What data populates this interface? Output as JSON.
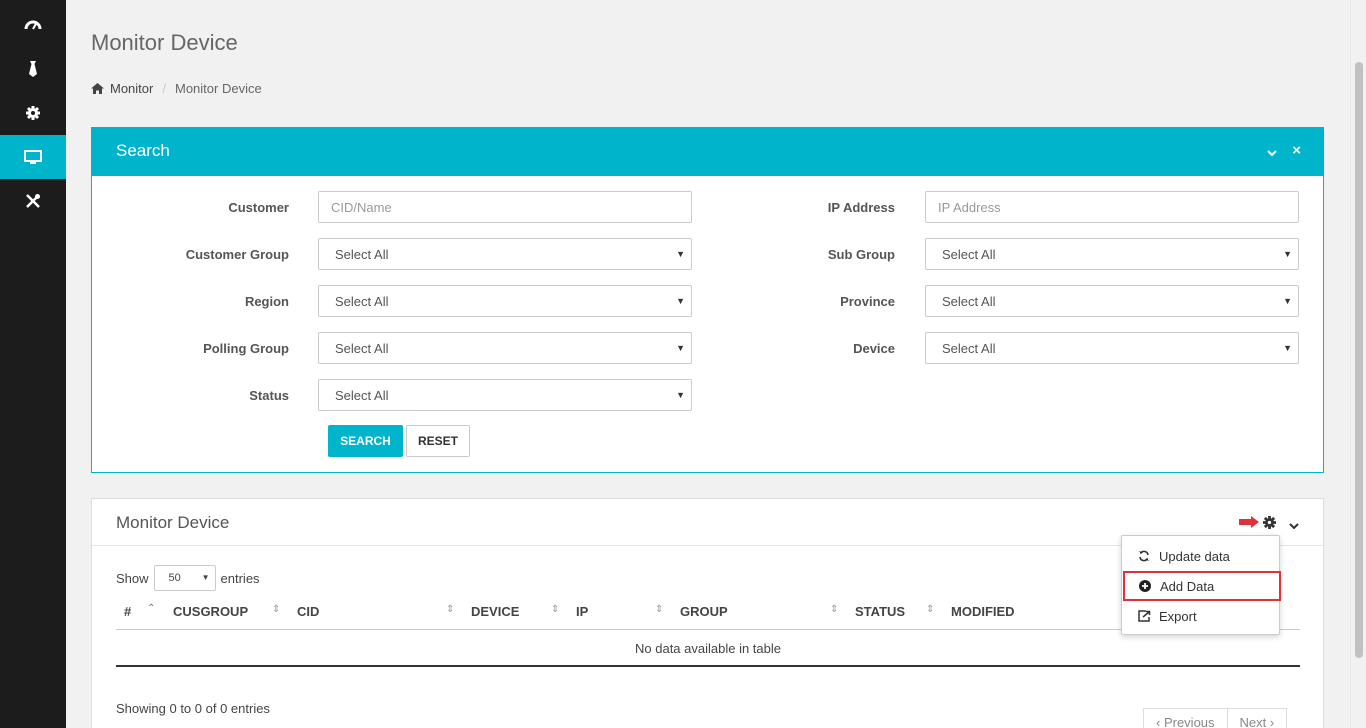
{
  "sidebar": {
    "items": [
      {
        "icon": "dashboard-icon",
        "active": false
      },
      {
        "icon": "tie-icon",
        "active": false
      },
      {
        "icon": "gear-icon",
        "active": false
      },
      {
        "icon": "monitor-icon",
        "active": true
      },
      {
        "icon": "tools-icon",
        "active": false
      }
    ]
  },
  "page": {
    "title": "Monitor Device",
    "breadcrumb": {
      "home": "Monitor",
      "current": "Monitor Device",
      "separator": "/"
    }
  },
  "search": {
    "title": "Search",
    "fields": {
      "customer": {
        "label": "Customer",
        "placeholder": "CID/Name"
      },
      "ip_address": {
        "label": "IP Address",
        "placeholder": "IP Address"
      },
      "customer_group": {
        "label": "Customer Group",
        "value": "Select All"
      },
      "sub_group": {
        "label": "Sub Group",
        "value": "Select All"
      },
      "region": {
        "label": "Region",
        "value": "Select All"
      },
      "province": {
        "label": "Province",
        "value": "Select All"
      },
      "polling_group": {
        "label": "Polling Group",
        "value": "Select All"
      },
      "device": {
        "label": "Device",
        "value": "Select All"
      },
      "status": {
        "label": "Status",
        "value": "Select All"
      }
    },
    "search_label": "SEARCH",
    "reset_label": "RESET"
  },
  "monitor": {
    "title": "Monitor Device",
    "show_label": "Show",
    "entries_label": "entries",
    "page_length": "50",
    "columns": [
      "#",
      "CUSGROUP",
      "CID",
      "DEVICE",
      "IP",
      "GROUP",
      "STATUS",
      "MODIFIED"
    ],
    "empty_text": "No data available in table",
    "info": "Showing 0 to 0 of 0 entries",
    "prev_label": "Previous",
    "next_label": "Next"
  },
  "menu": {
    "items": [
      {
        "label": "Update data",
        "icon": "refresh-icon"
      },
      {
        "label": "Add Data",
        "icon": "plus-circle-icon",
        "highlighted": true
      },
      {
        "label": "Export",
        "icon": "export-icon"
      }
    ]
  },
  "colors": {
    "accent": "#00b4cc",
    "sidebar": "#1c1c1c",
    "highlight": "#e0303a"
  }
}
